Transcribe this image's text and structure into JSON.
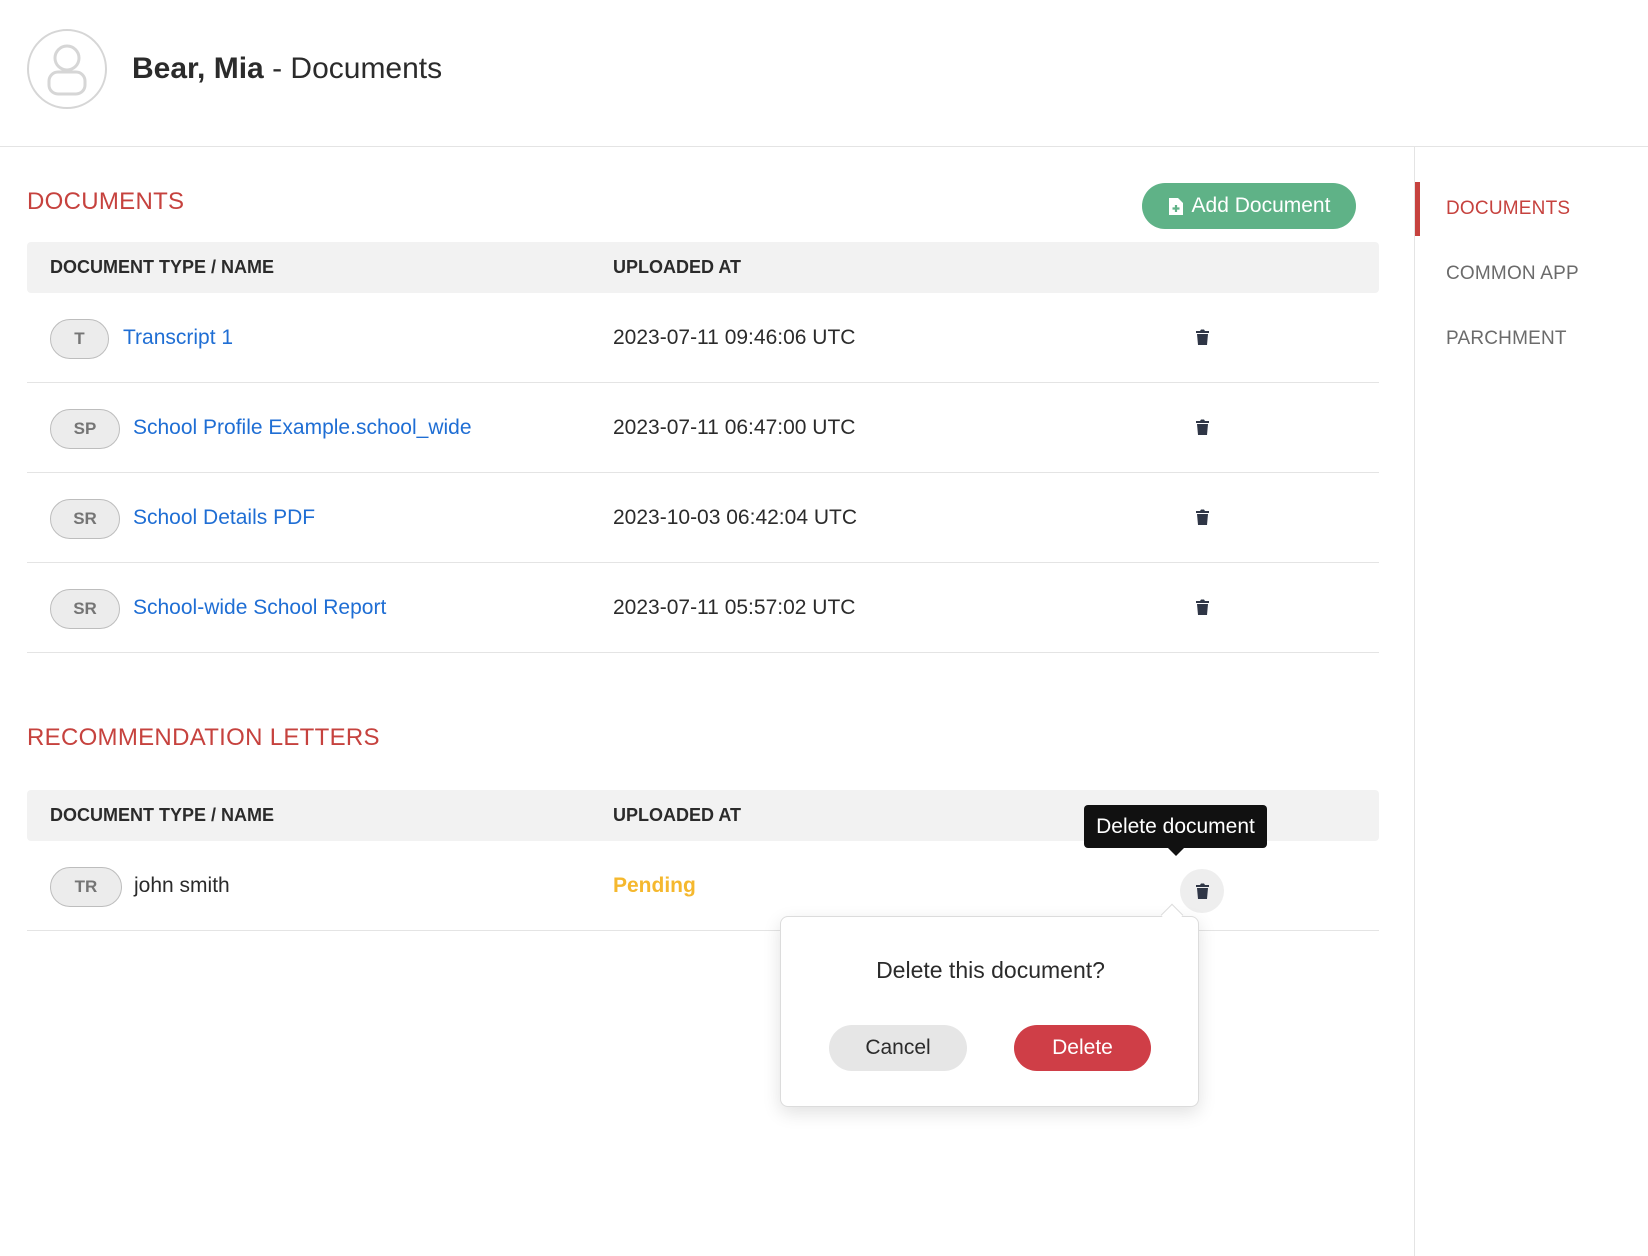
{
  "header": {
    "student_name": "Bear, Mia",
    "separator": " - ",
    "page_label": "Documents"
  },
  "sidebar": {
    "items": [
      {
        "label": "DOCUMENTS",
        "active": true
      },
      {
        "label": "COMMON APP",
        "active": false
      },
      {
        "label": "PARCHMENT",
        "active": false
      }
    ]
  },
  "documents": {
    "title": "DOCUMENTS",
    "add_button_label": "Add Document",
    "columns": [
      "DOCUMENT TYPE / NAME",
      "UPLOADED AT"
    ],
    "rows": [
      {
        "badge": "T",
        "name": "Transcript 1",
        "uploaded_at": "2023-07-11 09:46:06 UTC"
      },
      {
        "badge": "SP",
        "name": "School Profile Example.school_wide",
        "uploaded_at": "2023-07-11 06:47:00 UTC"
      },
      {
        "badge": "SR",
        "name": "School Details PDF",
        "uploaded_at": "2023-10-03 06:42:04 UTC"
      },
      {
        "badge": "SR",
        "name": "School-wide School Report",
        "uploaded_at": "2023-07-11 05:57:02 UTC"
      }
    ]
  },
  "recommendations": {
    "title": "RECOMMENDATION LETTERS",
    "columns": [
      "DOCUMENT TYPE / NAME",
      "UPLOADED AT"
    ],
    "rows": [
      {
        "badge": "TR",
        "name": "john smith",
        "uploaded_at": "Pending"
      }
    ]
  },
  "tooltip": {
    "text": "Delete document"
  },
  "confirm": {
    "question": "Delete this document?",
    "cancel_label": "Cancel",
    "delete_label": "Delete"
  },
  "colors": {
    "accent": "#c6423e",
    "add_button": "#5fb287",
    "link": "#1f6ed4",
    "pending": "#f5b82e",
    "danger": "#cf3e47"
  },
  "icons": {
    "avatar": "user-avatar-icon",
    "add": "file-plus-icon",
    "delete": "trash-icon"
  }
}
